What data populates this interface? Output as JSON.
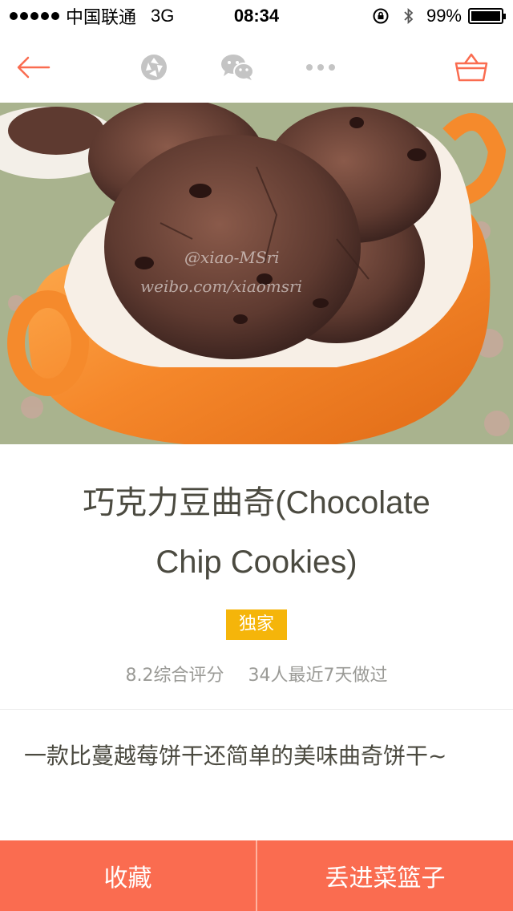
{
  "status_bar": {
    "carrier": "中国联通",
    "network": "3G",
    "time": "08:34",
    "battery": "99%",
    "battery_level": 0.99
  },
  "nav": {
    "back_icon": "arrow-left-icon",
    "camera_icon": "aperture-icon",
    "wechat_icon": "wechat-icon",
    "more_icon": "more-dots-icon",
    "basket_icon": "basket-icon",
    "accent_color": "#fa6c50"
  },
  "recipe": {
    "title": "巧克力豆曲奇(Chocolate Chip Cookies)",
    "badge": "独家",
    "rating": "8.2综合评分",
    "made_recent": "34人最近7天做过",
    "description": "一款比蔓越莓饼干还简单的美味曲奇饼干~"
  },
  "hero_image": {
    "watermark_line1": "@xiao-MSri",
    "watermark_line2": "weibo.com/xiaomsri"
  },
  "bottom_bar": {
    "favorite_label": "收藏",
    "add_basket_label": "丢进菜篮子"
  }
}
